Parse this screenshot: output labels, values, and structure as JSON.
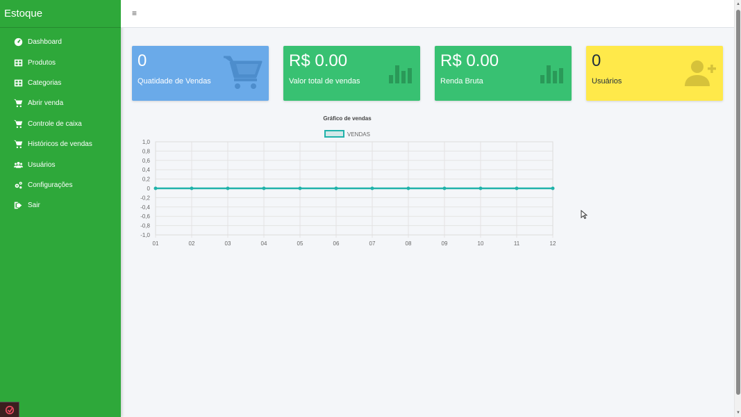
{
  "app": {
    "title": "Estoque"
  },
  "sidebar": {
    "items": [
      {
        "label": "Dashboard",
        "icon": "dashboard-gauge-icon"
      },
      {
        "label": "Produtos",
        "icon": "table-grid-icon"
      },
      {
        "label": "Categorias",
        "icon": "table-grid-icon"
      },
      {
        "label": "Abrir venda",
        "icon": "shopping-cart-icon"
      },
      {
        "label": "Controle de caixa",
        "icon": "shopping-cart-icon"
      },
      {
        "label": "Históricos de vendas",
        "icon": "shopping-cart-icon"
      },
      {
        "label": "Usuários",
        "icon": "users-icon"
      },
      {
        "label": "Configurações",
        "icon": "cogs-icon"
      },
      {
        "label": "Sair",
        "icon": "sign-out-icon"
      }
    ]
  },
  "topbar": {
    "menu_icon": "≡"
  },
  "cards": [
    {
      "value": "0",
      "label": "Quatidade de Vendas",
      "color": "#6aaae9",
      "icon": "shopping-cart-icon"
    },
    {
      "value": "R$ 0.00",
      "label": "Valor total de vendas",
      "color": "#38c172",
      "icon": "bar-chart-icon"
    },
    {
      "value": "R$ 0.00",
      "label": "Renda Bruta",
      "color": "#38c172",
      "icon": "bar-chart-icon"
    },
    {
      "value": "0",
      "label": "Usuários",
      "color": "#ffe94a",
      "icon": "user-plus-icon"
    }
  ],
  "chart_data": {
    "type": "line",
    "title": "Gráfico de vendas",
    "categories": [
      "01",
      "02",
      "03",
      "04",
      "05",
      "06",
      "07",
      "08",
      "09",
      "10",
      "11",
      "12"
    ],
    "series": [
      {
        "name": "VENDAS",
        "values": [
          0,
          0,
          0,
          0,
          0,
          0,
          0,
          0,
          0,
          0,
          0,
          0
        ],
        "color": "#20b2aa"
      }
    ],
    "yticks": [
      "1,0",
      "0,8",
      "0,6",
      "0,4",
      "0,2",
      "0",
      "-0,2",
      "-0,4",
      "-0,6",
      "-0,8",
      "-1,0"
    ],
    "ylim": [
      -1,
      1
    ],
    "grid": true,
    "legend": "top"
  }
}
